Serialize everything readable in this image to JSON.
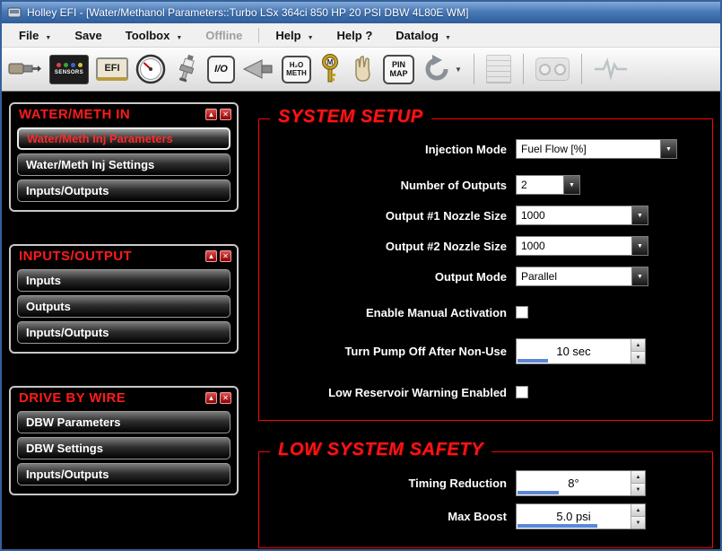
{
  "colors": {
    "accent_red": "#ff0000",
    "titlebar_blue": "#4a7ab8",
    "value_indicator_blue": "#5b87d6",
    "background": "#000000"
  },
  "window": {
    "title": "Holley EFI - [Water/Methanol Parameters::Turbo LSx 364ci 850 HP 20 PSI DBW 4L80E WM]"
  },
  "menubar": {
    "items": [
      {
        "label": "File",
        "has_arrow": true,
        "disabled": false
      },
      {
        "label": "Save",
        "has_arrow": false,
        "disabled": false
      },
      {
        "label": "Toolbox",
        "has_arrow": true,
        "disabled": false
      },
      {
        "label": "Offline",
        "has_arrow": false,
        "disabled": true
      },
      {
        "label": "Help",
        "has_arrow": true,
        "disabled": false
      },
      {
        "label": "Help ?",
        "has_arrow": false,
        "disabled": false
      },
      {
        "label": "Datalog",
        "has_arrow": true,
        "disabled": false
      }
    ]
  },
  "toolbar": {
    "icons": [
      {
        "name": "injector-icon"
      },
      {
        "name": "sensors-icon",
        "label": "SENSORS"
      },
      {
        "name": "efi-icon",
        "label": "EFI"
      },
      {
        "name": "gauge-icon"
      },
      {
        "name": "sparkplug-icon"
      },
      {
        "name": "io-icon",
        "label": "I/O"
      },
      {
        "name": "fuel-filter-icon"
      },
      {
        "name": "water-meth-icon",
        "label_line1": "H₂O",
        "label_line2": "METH"
      },
      {
        "name": "ignition-key-icon",
        "label": "M"
      },
      {
        "name": "hand-tool-icon"
      },
      {
        "name": "pin-map-icon",
        "label_line1": "PIN",
        "label_line2": "MAP"
      },
      {
        "name": "sync-icon"
      },
      {
        "name": "notes-icon",
        "disabled": true
      },
      {
        "name": "dashboard-icon",
        "disabled": true
      },
      {
        "name": "pulse-icon",
        "disabled": true
      }
    ]
  },
  "sidebar": {
    "panels": [
      {
        "title": "WATER/METH IN",
        "items": [
          {
            "label": "Water/Meth Inj Parameters",
            "active": true
          },
          {
            "label": "Water/Meth Inj Settings",
            "active": false
          },
          {
            "label": "Inputs/Outputs",
            "active": false
          }
        ]
      },
      {
        "title": "INPUTS/OUTPUT",
        "items": [
          {
            "label": "Inputs",
            "active": false
          },
          {
            "label": "Outputs",
            "active": false
          },
          {
            "label": "Inputs/Outputs",
            "active": false
          }
        ]
      },
      {
        "title": "DRIVE BY WIRE",
        "items": [
          {
            "label": "DBW Parameters",
            "active": false
          },
          {
            "label": "DBW Settings",
            "active": false
          },
          {
            "label": "Inputs/Outputs",
            "active": false
          }
        ]
      }
    ]
  },
  "main": {
    "system_setup": {
      "title": "SYSTEM SETUP",
      "injection_mode": {
        "label": "Injection Mode",
        "value": "Fuel Flow [%]"
      },
      "number_of_outputs": {
        "label": "Number of Outputs",
        "value": "2"
      },
      "output1_nozzle": {
        "label": "Output #1 Nozzle Size",
        "value": "1000"
      },
      "output2_nozzle": {
        "label": "Output #2 Nozzle Size",
        "value": "1000"
      },
      "output_mode": {
        "label": "Output Mode",
        "value": "Parallel"
      },
      "manual_activation": {
        "label": "Enable Manual Activation",
        "checked": false
      },
      "pump_off": {
        "label": "Turn Pump Off After Non-Use",
        "value": "10 sec",
        "slider_width": "24%"
      },
      "low_reservoir": {
        "label": "Low Reservoir Warning Enabled",
        "checked": false
      }
    },
    "low_system_safety": {
      "title": "LOW SYSTEM SAFETY",
      "timing_reduction": {
        "label": "Timing Reduction",
        "value": "8°",
        "slider_width": "32%"
      },
      "max_boost": {
        "label": "Max Boost",
        "value": "5.0 psi",
        "slider_width": "62%"
      }
    }
  }
}
